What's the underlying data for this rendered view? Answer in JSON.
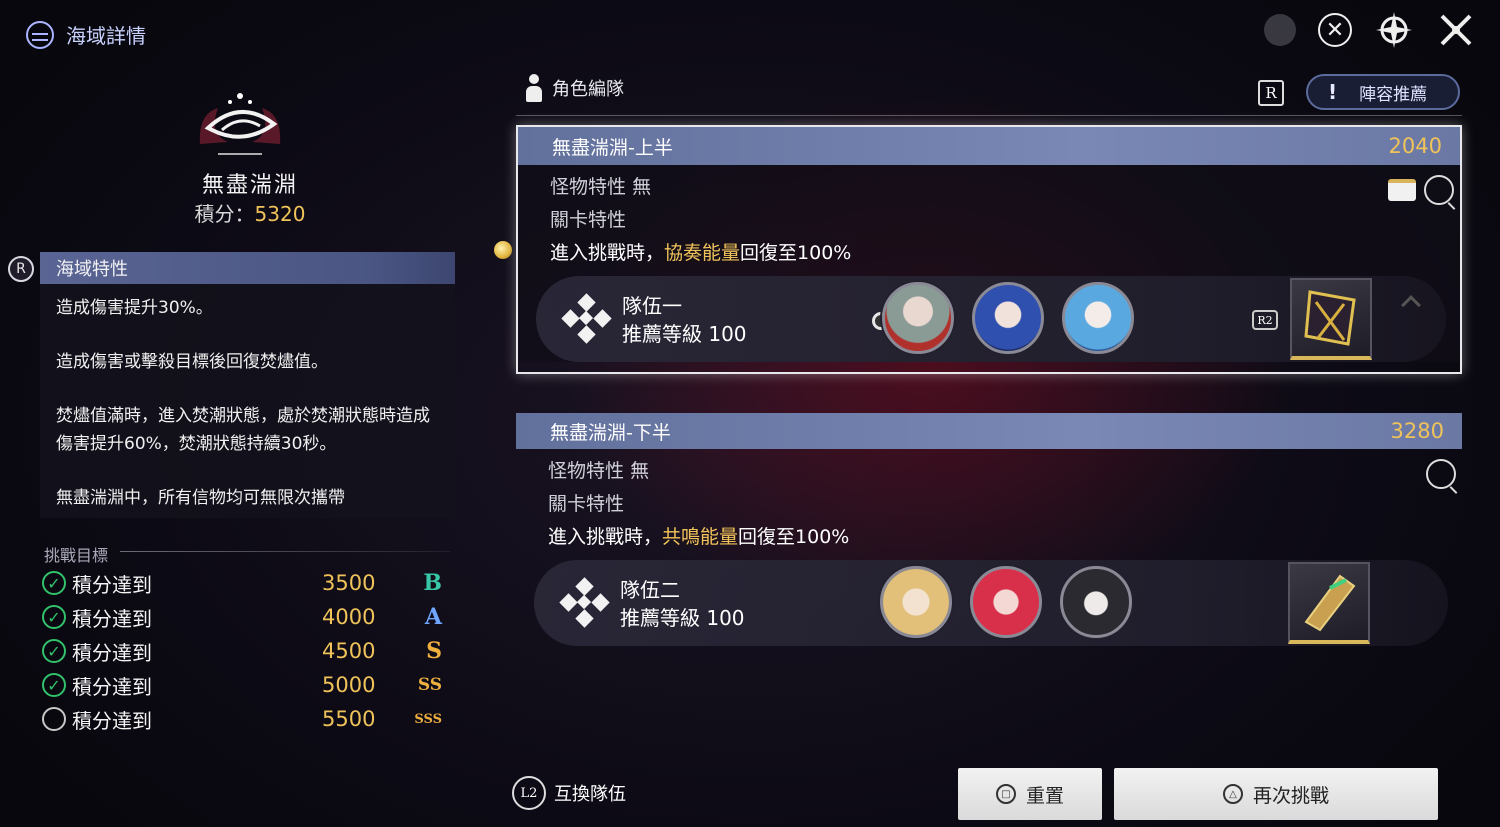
{
  "header": {
    "title": "海域詳情",
    "icons": [
      "globe-icon",
      "info-icon",
      "close-circle-icon",
      "compass-icon",
      "close-x-icon"
    ]
  },
  "left": {
    "sea_name": "無盡湍淵",
    "score_label": "積分：",
    "score_value": "5320",
    "feature_badge": "R",
    "feature_title": "海域特性",
    "features": [
      "造成傷害提升30%。",
      "造成傷害或擊殺目標後回復焚燼值。",
      "焚燼值滿時，進入焚潮狀態，處於焚潮狀態時造成傷害提升60%，焚潮狀態持續30秒。",
      "無盡湍淵中，所有信物均可無限次攜帶"
    ],
    "goals_title": "挑戰目標",
    "goals": [
      {
        "label": "積分達到",
        "value": "3500",
        "rank": "B",
        "done": true,
        "color": "#38c8a8"
      },
      {
        "label": "積分達到",
        "value": "4000",
        "rank": "A",
        "done": true,
        "color": "#6fa6ff"
      },
      {
        "label": "積分達到",
        "value": "4500",
        "rank": "S",
        "done": true,
        "color": "#f0b040"
      },
      {
        "label": "積分達到",
        "value": "5000",
        "rank": "SS",
        "done": true,
        "color": "#f0b040"
      },
      {
        "label": "積分達到",
        "value": "5500",
        "rank": "SSS",
        "done": false,
        "color": "#f0b040"
      }
    ]
  },
  "right": {
    "section_title": "角色編隊",
    "r_key": "R",
    "recommend_mark": "!",
    "recommend_label": "陣容推薦",
    "stages": [
      {
        "name": "無盡湍淵-上半",
        "points": "2040",
        "monster_label": "怪物特性",
        "monster_value": "無",
        "stage_label": "關卡特性",
        "effect_prefix": "進入挑戰時，",
        "effect_highlight": "協奏能量",
        "effect_suffix": "回復至100%",
        "team_name": "隊伍一",
        "team_level": "推薦等級 100",
        "r2_key": "R2"
      },
      {
        "name": "無盡湍淵-下半",
        "points": "3280",
        "monster_label": "怪物特性",
        "monster_value": "無",
        "stage_label": "關卡特性",
        "effect_prefix": "進入挑戰時，",
        "effect_highlight": "共鳴能量",
        "effect_suffix": "回復至100%",
        "team_name": "隊伍二",
        "team_level": "推薦等級 100"
      }
    ]
  },
  "footer": {
    "swap_key": "L2",
    "swap_label": "互換隊伍",
    "reset_label": "重置",
    "retry_label": "再次挑戰"
  },
  "colors": {
    "gold": "#f0c35a",
    "stage_bar": "#6b78a4",
    "feature_bar": "#4a5583"
  }
}
